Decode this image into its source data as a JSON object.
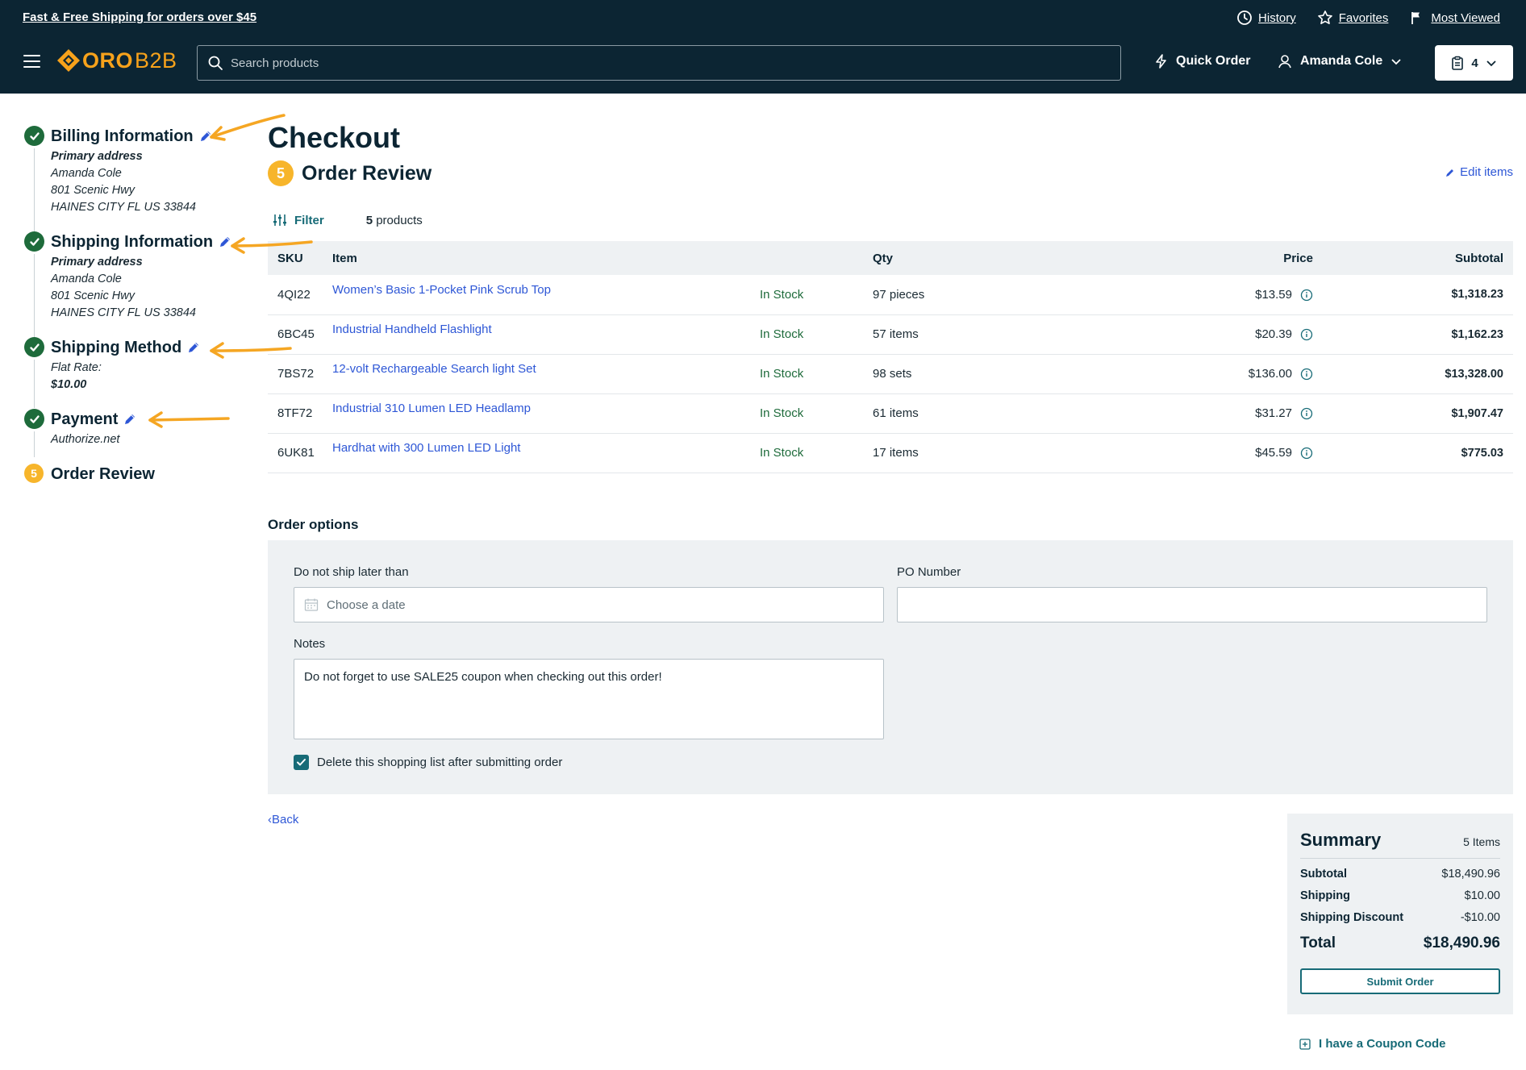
{
  "header": {
    "promo": "Fast & Free Shipping for orders over $45",
    "links": {
      "history": "History",
      "favorites": "Favorites",
      "most_viewed": "Most Viewed"
    },
    "logo": {
      "part1": "ORO",
      "part2": "B2B"
    },
    "search": {
      "placeholder": "Search products"
    },
    "quick_order": "Quick Order",
    "user_name": "Amanda Cole",
    "cart_count": "4",
    "colors": {
      "background": "#0c2533",
      "accent": "#f7a21b"
    }
  },
  "steps": [
    {
      "title": "Billing Information",
      "lines": [
        "Primary address",
        "Amanda Cole",
        "801 Scenic Hwy",
        "HAINES CITY FL US 33844"
      ]
    },
    {
      "title": "Shipping Information",
      "lines": [
        "Primary address",
        "Amanda Cole",
        "801 Scenic Hwy",
        "HAINES CITY FL US 33844"
      ]
    },
    {
      "title": "Shipping Method",
      "lines": [
        "Flat Rate:",
        "$10.00"
      ]
    },
    {
      "title": "Payment",
      "lines": [
        "Authorize.net"
      ]
    },
    {
      "title": "Order Review",
      "number": "5"
    }
  ],
  "main": {
    "title": "Checkout",
    "section_number": "5",
    "section_title": "Order Review",
    "edit_items": "Edit items",
    "filter": "Filter",
    "product_count": "5",
    "product_count_suffix": " products"
  },
  "table": {
    "headers": {
      "sku": "SKU",
      "item": "Item",
      "qty": "Qty",
      "price": "Price",
      "subtotal": "Subtotal"
    },
    "rows": [
      {
        "sku": "4QI22",
        "item": "Women’s Basic 1-Pocket Pink Scrub Top",
        "stock": "In Stock",
        "qty": "97 pieces",
        "price": "$13.59",
        "subtotal": "$1,318.23"
      },
      {
        "sku": "6BC45",
        "item": "Industrial Handheld Flashlight",
        "stock": "In Stock",
        "qty": "57 items",
        "price": "$20.39",
        "subtotal": "$1,162.23"
      },
      {
        "sku": "7BS72",
        "item": "12-volt Rechargeable Search light Set",
        "stock": "In Stock",
        "qty": "98 sets",
        "price": "$136.00",
        "subtotal": "$13,328.00"
      },
      {
        "sku": "8TF72",
        "item": "Industrial 310 Lumen LED Headlamp",
        "stock": "In Stock",
        "qty": "61 items",
        "price": "$31.27",
        "subtotal": "$1,907.47"
      },
      {
        "sku": "6UK81",
        "item": "Hardhat with 300 Lumen LED Light",
        "stock": "In Stock",
        "qty": "17 items",
        "price": "$45.59",
        "subtotal": "$775.03"
      }
    ]
  },
  "options": {
    "title": "Order options",
    "ship_label": "Do not ship later than",
    "ship_placeholder": "Choose a date",
    "po_label": "PO Number",
    "po_value": "",
    "notes_label": "Notes",
    "notes_value": "Do not forget to use SALE25 coupon when checking out this order!",
    "delete_label": "Delete this shopping list after submitting order",
    "delete_checked": true
  },
  "back": "Back",
  "summary": {
    "title": "Summary",
    "items": "5 Items",
    "subtotal_label": "Subtotal",
    "subtotal": "$18,490.96",
    "shipping_label": "Shipping",
    "shipping": "$10.00",
    "discount_label": "Shipping Discount",
    "discount": "-$10.00",
    "total_label": "Total",
    "total": "$18,490.96",
    "submit": "Submit Order"
  },
  "coupon": "I have a Coupon Code"
}
